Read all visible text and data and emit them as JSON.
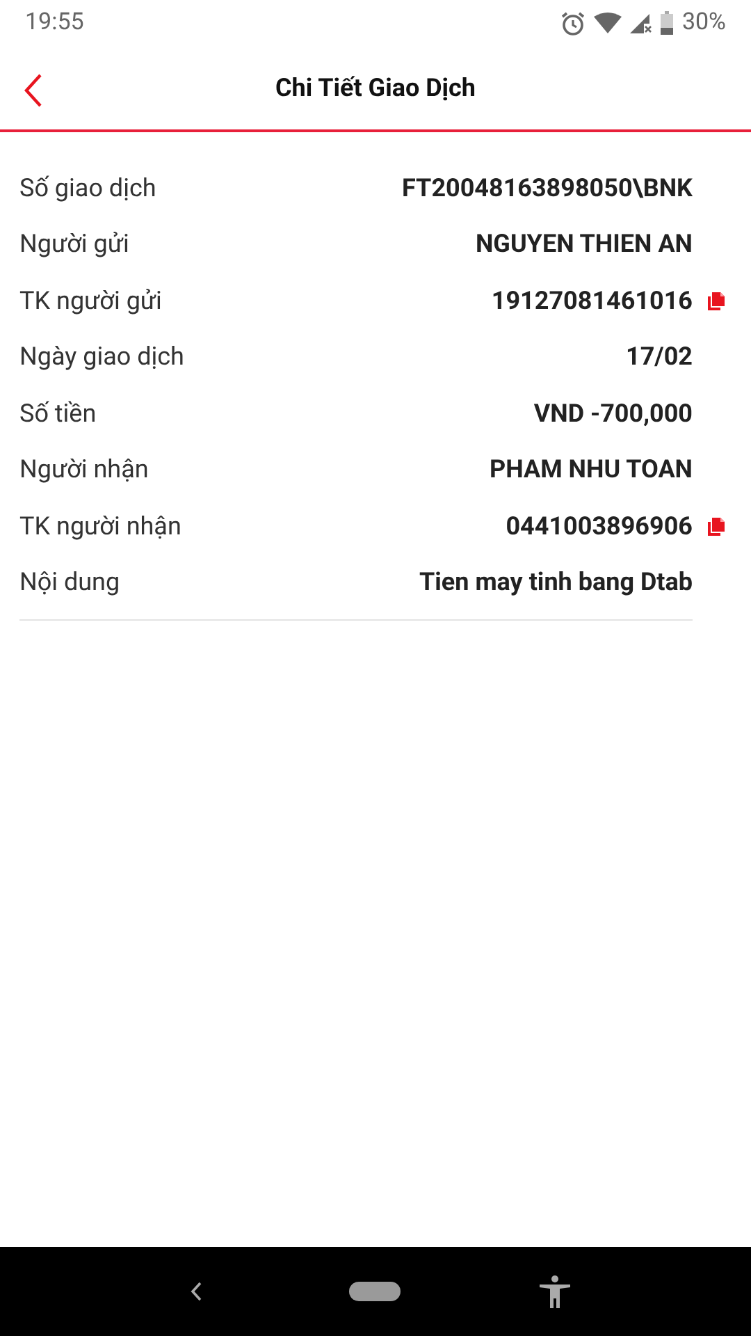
{
  "status_bar": {
    "time": "19:55",
    "battery": "30%"
  },
  "header": {
    "title": "Chi Tiết Giao Dịch"
  },
  "details": [
    {
      "label": "Số giao dịch",
      "value": "FT20048163898050\\BNK",
      "copy": false
    },
    {
      "label": "Người gửi",
      "value": "NGUYEN THIEN AN",
      "copy": false
    },
    {
      "label": "TK người gửi",
      "value": "19127081461016",
      "copy": true
    },
    {
      "label": "Ngày giao dịch",
      "value": "17/02",
      "copy": false
    },
    {
      "label": "Số tiền",
      "value": "VND -700,000",
      "copy": false
    },
    {
      "label": "Người nhận",
      "value": "PHAM NHU TOAN",
      "copy": false
    },
    {
      "label": "TK người nhận",
      "value": "0441003896906",
      "copy": true
    },
    {
      "label": "Nội dung",
      "value": "Tien may tinh bang Dtab",
      "copy": false
    }
  ]
}
